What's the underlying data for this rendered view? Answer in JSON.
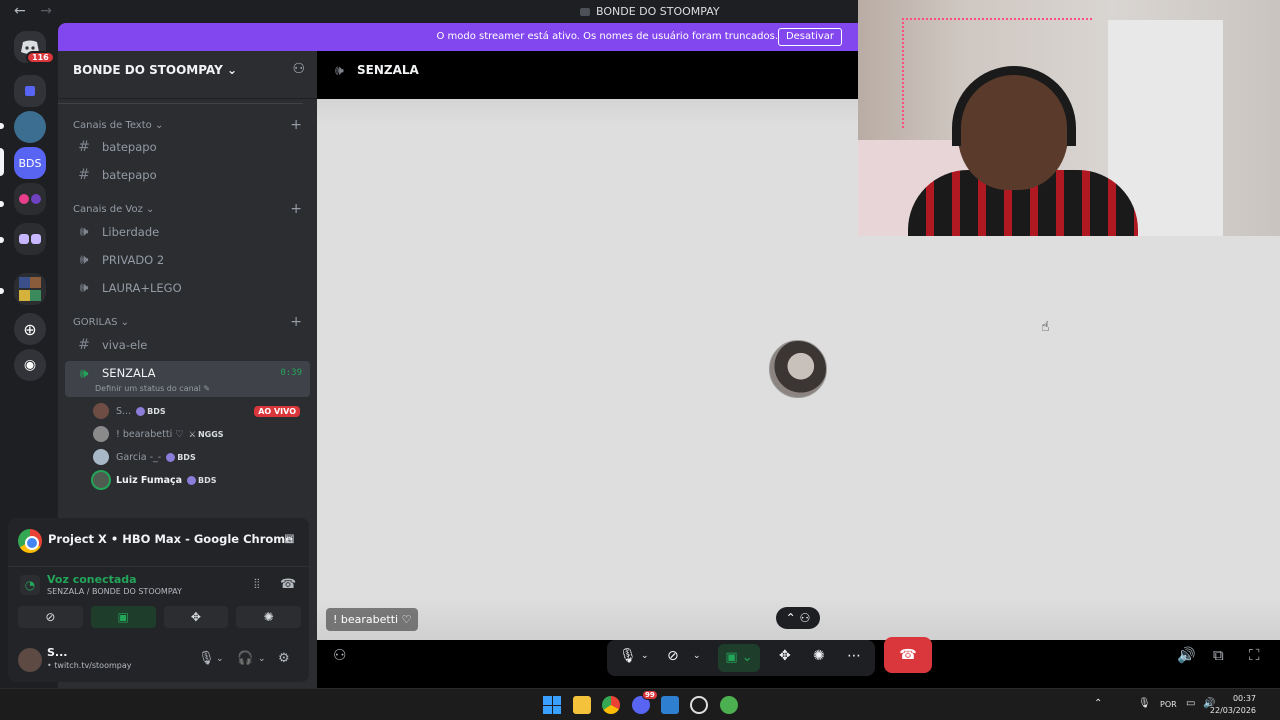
{
  "titlebar": {
    "back": "←",
    "forward": "→",
    "title": "BONDE DO STOOMPAY"
  },
  "rail": {
    "home_badge": "116",
    "server_abbrev": "BDS"
  },
  "banner": {
    "message": "O modo streamer está ativo. Os nomes de usuário foram truncados.",
    "button": "Desativar",
    "color": "#8347f0"
  },
  "guild": {
    "name": "BONDE DO STOOMPAY ⌄",
    "categories": [
      {
        "label": "Canais de Texto ⌄",
        "channels": [
          "batepapo",
          "batepapo"
        ]
      },
      {
        "label": "Canais de Voz ⌄",
        "channels": [
          "Liberdade",
          "PRIVADO 2",
          "LAURA+LEGO"
        ]
      },
      {
        "label": "GORILAS ⌄",
        "channels": [
          "viva-ele"
        ]
      }
    ],
    "active_channel": {
      "name": "SENZALA",
      "timer": "0:39",
      "status_hint": "Definir um status do canal ✎"
    },
    "voice_users": [
      {
        "name": "S...",
        "tag": "BDS",
        "live": "AO VIVO"
      },
      {
        "name": "! bearabetti ♡",
        "tag": "NGGS"
      },
      {
        "name": "Garcia -_-",
        "tag": "BDS"
      },
      {
        "name": "Luiz Fumaça",
        "tag": "BDS"
      }
    ]
  },
  "stream_panel": {
    "title": "Project X • HBO Max - Google Chrome"
  },
  "voice_panel": {
    "status": "Voz conectada",
    "location": "SENZALA / BONDE DO STOOMPAY"
  },
  "user_panel": {
    "name": "S...",
    "status": "• twitch.tv/stoompay"
  },
  "main": {
    "channel": "SENZALA",
    "speaker_name": "! bearabetti ♡"
  },
  "taskbar": {
    "lang": "POR",
    "time": "00:37",
    "date": "22/03/2026",
    "discord_badge": "99"
  },
  "colors": {
    "accent_green": "#23a55a",
    "danger_red": "#da373c"
  }
}
